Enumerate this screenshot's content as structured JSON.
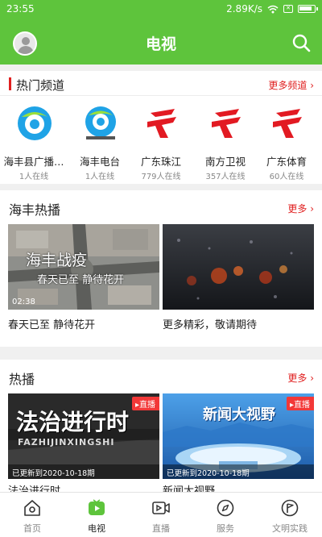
{
  "status_bar": {
    "time": "23:55",
    "speed": "2.89K/s",
    "sim": "✕"
  },
  "app_bar": {
    "title": "电视"
  },
  "hot_channels": {
    "title": "热门频道",
    "more": "更多频道 ›",
    "items": [
      {
        "name": "海丰县广播…",
        "count": "1人在线",
        "logo": "haifeng-radio-logo"
      },
      {
        "name": "海丰电台",
        "count": "1人在线",
        "logo": "haifeng-station-logo"
      },
      {
        "name": "广东珠江",
        "count": "779人在线",
        "logo": "guangdong-tv-logo"
      },
      {
        "name": "南方卫视",
        "count": "357人在线",
        "logo": "guangdong-tv-logo"
      },
      {
        "name": "广东体育",
        "count": "60人在线",
        "logo": "guangdong-tv-logo"
      }
    ]
  },
  "haifeng_hot": {
    "title": "海丰热播",
    "more": "更多 ›",
    "items": [
      {
        "caption": "春天已至 静待花开",
        "duration": "02:38",
        "overlay_line1": "海丰战疫",
        "overlay_line2": "春天已至 静待花开"
      },
      {
        "caption": "更多精彩，敬请期待"
      }
    ]
  },
  "hot": {
    "title": "热播",
    "more": "更多 ›",
    "items": [
      {
        "caption": "法治进行时",
        "badge": "直播",
        "updated": "已更新到2020-10-18期",
        "overlay_cn": "法治进行时",
        "overlay_pinyin": "FAZHIJINXINGSHI"
      },
      {
        "caption": "新闻大视野",
        "badge": "直播",
        "updated": "已更新到2020-10-18期",
        "overlay_cn": "新闻大视野"
      }
    ]
  },
  "tab_bar": {
    "items": [
      {
        "label": "首页",
        "icon": "home-icon"
      },
      {
        "label": "电视",
        "icon": "tv-icon",
        "active": true
      },
      {
        "label": "直播",
        "icon": "live-video-icon"
      },
      {
        "label": "服务",
        "icon": "compass-icon"
      },
      {
        "label": "文明实践",
        "icon": "flag-icon"
      }
    ]
  },
  "colors": {
    "brand_green": "#5ec43c",
    "accent_red": "#e02020",
    "badge_red": "#f23838"
  }
}
